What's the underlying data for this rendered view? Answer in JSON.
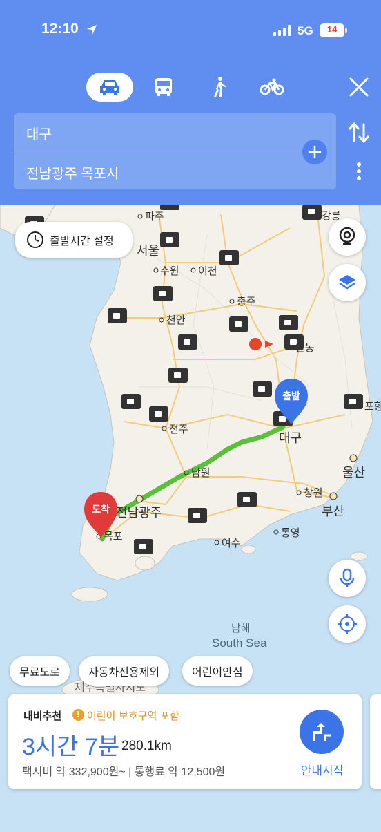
{
  "status_bar": {
    "time": "12:10",
    "network": "5G",
    "battery": "14"
  },
  "modes": [
    {
      "name": "car",
      "icon": "car-icon",
      "selected": true
    },
    {
      "name": "bus",
      "icon": "bus-icon"
    },
    {
      "name": "walk",
      "icon": "walk-icon"
    },
    {
      "name": "bike",
      "icon": "bike-icon"
    }
  ],
  "route": {
    "origin": "대구",
    "destination": "전남광주 목포시"
  },
  "controls": {
    "depart_time": "출발시간 설정"
  },
  "map": {
    "cities": {
      "seoul": "서울",
      "paju": "파주",
      "suwon": "수원",
      "icheon": "이천",
      "chungju": "충주",
      "cheonan": "천안",
      "andong": "안동",
      "jeonju": "전주",
      "daegu": "대구",
      "namwon": "남원",
      "ulsan": "울산",
      "changwon": "창원",
      "busan": "부산",
      "jeonnam": "전남광주",
      "mokpo": "목포",
      "yeosu": "여수",
      "tongyeong": "통영",
      "pohang": "포항",
      "gangneung": "강릉",
      "sea_ko": "남해",
      "sea_en": "South Sea",
      "jeju": "제주특별자치도"
    },
    "start_marker": "출발",
    "end_marker": "도착",
    "route_color": "#58c03a"
  },
  "filters": [
    "무료도로",
    "자동차전용제외",
    "어린이안심"
  ],
  "summary": {
    "label": "내비추천",
    "warning": "어린이 보호구역 포함",
    "duration": "3시간 7분",
    "distance": "280.1km",
    "fare": "택시비 약 332,900원~ | 통행료 약 12,500원",
    "start_button": "안내시작"
  },
  "colors": {
    "header": "#5f8ef0",
    "accent": "#3b74e6",
    "start_pin": "#3b74e6",
    "end_pin": "#e03a3a"
  }
}
